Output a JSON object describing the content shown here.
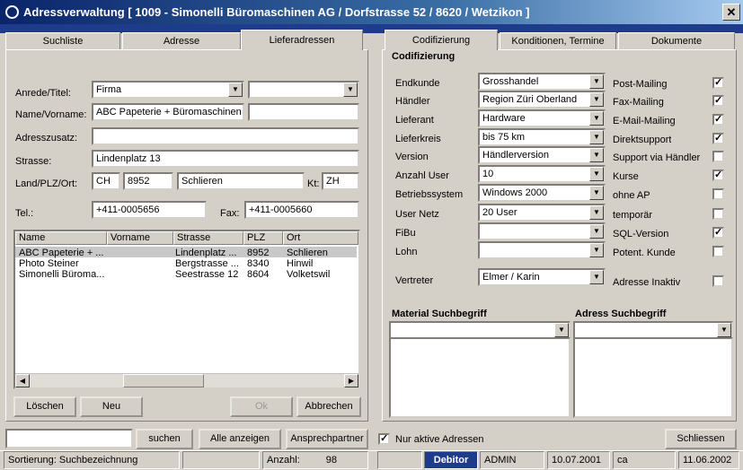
{
  "window": {
    "title": "Adressverwaltung  [ 1009 - Simonelli Büromaschinen AG / Dorfstrasse 52 / 8620 / Wetzikon ]",
    "close": "✕"
  },
  "left_tabs": [
    "Suchliste",
    "Adresse",
    "Lieferadressen"
  ],
  "right_tabs": [
    "Codifizierung",
    "Konditionen, Termine",
    "Dokumente"
  ],
  "address": {
    "anrede_label": "Anrede/Titel:",
    "anrede_value": "Firma",
    "titel_value": "",
    "name_label": "Name/Vorname:",
    "name_value": "ABC Papeterie + Büromaschinen",
    "vorname_value": "",
    "zusatz_label": "Adresszusatz:",
    "zusatz_value": "",
    "strasse_label": "Strasse:",
    "strasse_value": "Lindenplatz 13",
    "land_label": "Land/PLZ/Ort:",
    "land_value": "CH",
    "plz_value": "8952",
    "ort_value": "Schlieren",
    "kt_label": "Kt:",
    "kt_value": "ZH",
    "tel_label": "Tel.:",
    "tel_value": "+411-0005656",
    "fax_label": "Fax:",
    "fax_value": "+411-0005660"
  },
  "list": {
    "headers": [
      "Name",
      "Vorname",
      "Strasse",
      "PLZ",
      "Ort"
    ],
    "rows": [
      [
        "ABC Papeterie + ...",
        "",
        "Lindenplatz ...",
        "8952",
        "Schlieren"
      ],
      [
        "Photo Steiner",
        "",
        "Bergstrasse ...",
        "8340",
        "Hinwil"
      ],
      [
        "Simonelli Büroma...",
        "",
        "Seestrasse 12",
        "8604",
        "Volketswil"
      ]
    ]
  },
  "buttons": {
    "loeschen": "Löschen",
    "neu": "Neu",
    "ok": "Ok",
    "abbrechen": "Abbrechen",
    "suchen": "suchen",
    "alle": "Alle anzeigen",
    "ansprech": "Ansprechpartner",
    "schliessen": "Schliessen"
  },
  "search_value": "",
  "codif": {
    "title": "Codifizierung",
    "fields": [
      {
        "label": "Endkunde",
        "value": "Grosshandel"
      },
      {
        "label": "Händler",
        "value": "Region Züri Oberland"
      },
      {
        "label": "Lieferant",
        "value": "Hardware"
      },
      {
        "label": "Lieferkreis",
        "value": "bis 75 km"
      },
      {
        "label": "Version",
        "value": "Händlerversion"
      },
      {
        "label": "Anzahl User",
        "value": "10"
      },
      {
        "label": "Betriebssystem",
        "value": "Windows 2000"
      },
      {
        "label": "User Netz",
        "value": "20 User"
      },
      {
        "label": "FiBu",
        "value": ""
      },
      {
        "label": "Lohn",
        "value": ""
      }
    ],
    "vertreter_label": "Vertreter",
    "vertreter_value": "Elmer / Karin",
    "checks": [
      {
        "label": "Post-Mailing",
        "checked": true
      },
      {
        "label": "Fax-Mailing",
        "checked": true
      },
      {
        "label": "E-Mail-Mailing",
        "checked": true
      },
      {
        "label": "Direktsupport",
        "checked": true
      },
      {
        "label": "Support via Händler",
        "checked": false
      },
      {
        "label": "Kurse",
        "checked": true
      },
      {
        "label": "ohne AP",
        "checked": false
      },
      {
        "label": "temporär",
        "checked": false
      },
      {
        "label": "SQL-Version",
        "checked": true
      },
      {
        "label": "Potent. Kunde",
        "checked": false
      }
    ],
    "inaktiv_label": "Adresse Inaktiv",
    "inaktiv_checked": false,
    "material_label": "Material Suchbegriff",
    "adress_label": "Adress Suchbegriff"
  },
  "aktive_label": "Nur aktive Adressen",
  "aktive_checked": true,
  "status": {
    "sortierung_label": "Sortierung:",
    "sortierung_value": "Suchbezeichnung",
    "anzahl_label": "Anzahl:",
    "anzahl_value": "98",
    "debitor": "Debitor",
    "user": "ADMIN",
    "date1": "10.07.2001",
    "ca": "ca",
    "date2": "11.06.2002"
  },
  "colors": {
    "titlebar": "#0a246a",
    "debitor_bg": "#1f3c8c"
  }
}
